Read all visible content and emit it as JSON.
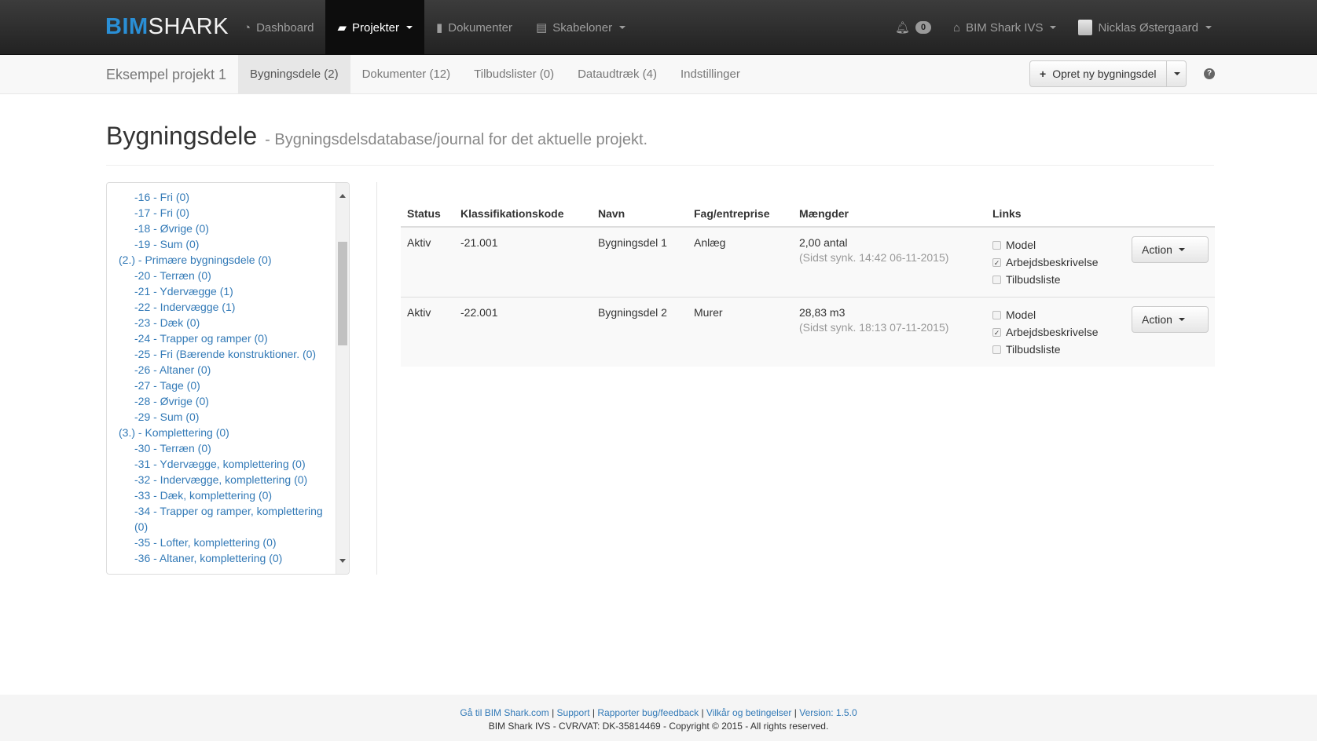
{
  "brand": {
    "part1": "BIM",
    "part2": "SHARK"
  },
  "nav": {
    "dashboard": "Dashboard",
    "projekter": "Projekter",
    "dokumenter": "Dokumenter",
    "skabeloner": "Skabeloner",
    "notifications_count": "0",
    "company": "BIM Shark IVS",
    "user": "Nicklas Østergaard"
  },
  "subnav": {
    "project_name": "Eksempel projekt 1",
    "tabs": [
      "Bygningsdele (2)",
      "Dokumenter (12)",
      "Tilbudslister (0)",
      "Dataudtræk (4)",
      "Indstillinger"
    ],
    "create_button": "Opret ny bygningsdel"
  },
  "page": {
    "title": "Bygningsdele",
    "subtitle": "- Bygningsdelsdatabase/journal for det aktuelle projekt."
  },
  "tree": [
    "-16 - Fri (0)",
    "-17 - Fri (0)",
    "-18 - Øvrige (0)",
    "-19 - Sum (0)",
    "(2.) - Primære bygningsdele (0)",
    "-20 - Terræn (0)",
    "-21 - Ydervægge (1)",
    "-22 - Indervægge (1)",
    "-23 - Dæk (0)",
    "-24 - Trapper og ramper (0)",
    "-25 - Fri (Bærende konstruktioner. (0)",
    "-26 - Altaner (0)",
    "-27 - Tage (0)",
    "-28 - Øvrige (0)",
    "-29 - Sum (0)",
    "(3.) - Komplettering (0)",
    "-30 - Terræn (0)",
    "-31 - Ydervægge, komplettering (0)",
    "-32 - Indervægge, komplettering (0)",
    "-33 - Dæk, komplettering (0)",
    "-34 - Trapper og ramper, komplettering",
    "(0)",
    "-35 - Lofter, komplettering (0)",
    "-36 - Altaner, komplettering (0)"
  ],
  "table": {
    "headers": [
      "Status",
      "Klassifikationskode",
      "Navn",
      "Fag/entreprise",
      "Mængder",
      "Links",
      ""
    ],
    "rows": [
      {
        "status": "Aktiv",
        "code": "-21.001",
        "name": "Bygningsdel 1",
        "fag": "Anlæg",
        "amount": "2,00 antal",
        "sync": "(Sidst synk. 14:42 06-11-2015)",
        "links": [
          "Model",
          "Arbejdsbeskrivelse",
          "Tilbudsliste"
        ],
        "action": "Action"
      },
      {
        "status": "Aktiv",
        "code": "-22.001",
        "name": "Bygningsdel 2",
        "fag": "Murer",
        "amount": "28,83 m3",
        "sync": "(Sidst synk. 18:13 07-11-2015)",
        "links": [
          "Model",
          "Arbejdsbeskrivelse",
          "Tilbudsliste"
        ],
        "action": "Action"
      }
    ]
  },
  "footer": {
    "link1": "Gå til BIM Shark.com",
    "link2": "Support",
    "link3": "Rapporter bug/feedback",
    "link4": "Vilkår og betingelser",
    "version": "Version: 1.5.0",
    "copyright": "BIM Shark IVS - CVR/VAT: DK-35814469 - Copyright © 2015 - All rights reserved."
  }
}
